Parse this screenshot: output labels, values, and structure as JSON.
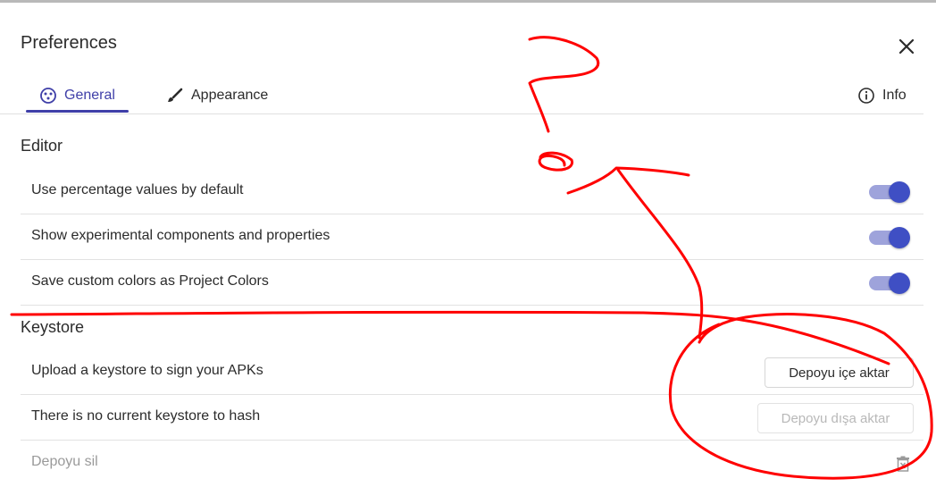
{
  "dialog": {
    "title": "Preferences"
  },
  "tabs": [
    {
      "label": "General",
      "icon": "palette-icon",
      "active": true
    },
    {
      "label": "Appearance",
      "icon": "brush-icon",
      "active": false
    },
    {
      "label": "Info",
      "icon": "info-icon",
      "active": false
    }
  ],
  "editor": {
    "title": "Editor",
    "rows": [
      {
        "label": "Use percentage values by default",
        "enabled": true
      },
      {
        "label": "Show experimental components and properties",
        "enabled": true
      },
      {
        "label": "Save custom colors as Project Colors",
        "enabled": true
      }
    ]
  },
  "keystore": {
    "title": "Keystore",
    "upload_label": "Upload a keystore to sign your APKs",
    "import_button": "Depoyu içe aktar",
    "hash_label": "There is no current keystore to hash",
    "export_button": "Depoyu dışa aktar",
    "delete_label": "Depoyu sil"
  },
  "colors": {
    "accent": "#3f3fa8",
    "toggle_track": "#9ea3db",
    "toggle_knob": "#3f4fc4",
    "annotation": "#ff0000"
  }
}
